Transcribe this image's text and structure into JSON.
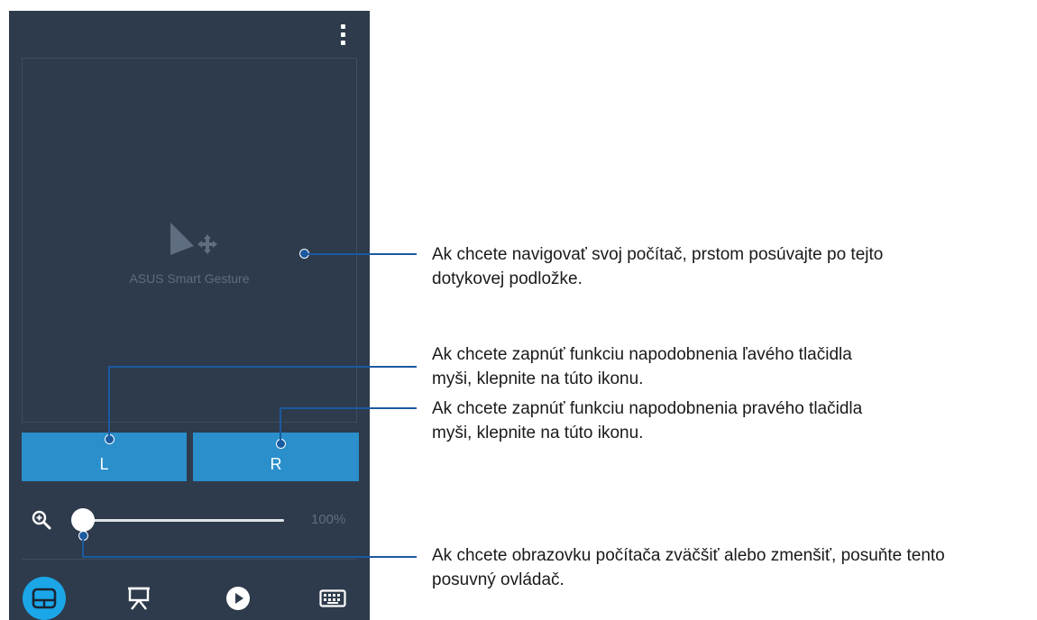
{
  "app": {
    "touchpad_label": "ASUS Smart Gesture",
    "left_button_label": "L",
    "right_button_label": "R",
    "zoom_value": "100%",
    "zoom_fraction": 0,
    "nav": [
      {
        "icon": "touchpad-icon",
        "active": true
      },
      {
        "icon": "presentation-icon",
        "active": false
      },
      {
        "icon": "play-icon",
        "active": false
      },
      {
        "icon": "keyboard-icon",
        "active": false
      }
    ],
    "colors": {
      "panel_bg": "#2e3b4c",
      "button_blue": "#2a8fcb",
      "active_nav": "#1ba6e8",
      "callout_line": "#1a5aa0"
    }
  },
  "callouts": [
    {
      "line1": "Ak chcete navigovať svoj počítač, prstom posúvajte po tejto",
      "line2": "dotykovej podložke."
    },
    {
      "line1": "Ak chcete zapnúť funkciu napodobnenia ľavého tlačidla",
      "line2": "myši, klepnite na túto ikonu."
    },
    {
      "line1": "Ak chcete zapnúť funkciu napodobnenia pravého tlačidla",
      "line2": "myši, klepnite na túto ikonu."
    },
    {
      "line1": "Ak chcete obrazovku počítača zväčšiť alebo zmenšiť, posuňte tento",
      "line2": "posuvný ovládač."
    }
  ]
}
